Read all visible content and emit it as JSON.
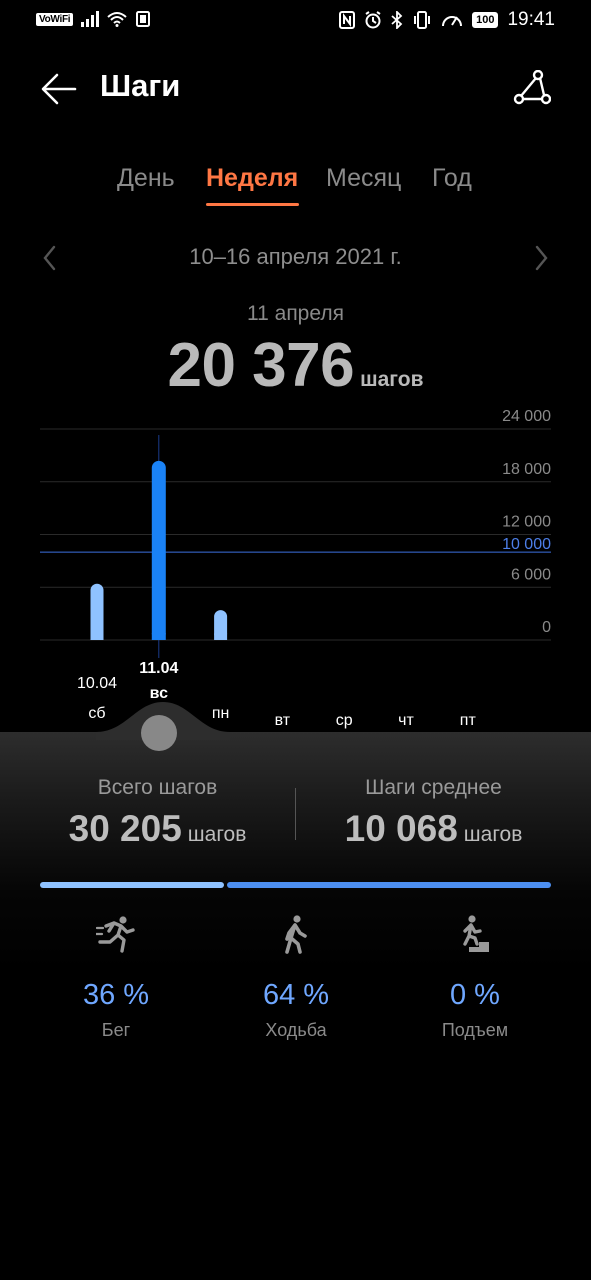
{
  "status": {
    "vowifi": "VoWiFi",
    "battery": "100",
    "time": "19:41"
  },
  "header": {
    "title": "Шаги",
    "back_icon": "arrow-left-icon",
    "share_icon": "share-icon"
  },
  "tabs": [
    {
      "label": "День",
      "active": false
    },
    {
      "label": "Неделя",
      "active": true
    },
    {
      "label": "Месяц",
      "active": false
    },
    {
      "label": "Год",
      "active": false
    }
  ],
  "range": "10–16 апреля 2021 г.",
  "selected": {
    "date": "11 апреля",
    "value": "20 376",
    "unit": "шагов"
  },
  "chart_data": {
    "type": "bar",
    "y_ticks": [
      "24 000",
      "18 000",
      "12 000",
      "6 000",
      "0"
    ],
    "ylim": [
      0,
      24000
    ],
    "goal_line": {
      "value": 10000,
      "label": "10 000",
      "color": "#3d6fe0"
    },
    "days": [
      {
        "date": "10.04",
        "day": "сб",
        "value": 6400,
        "color": "#8fc2ff"
      },
      {
        "date": "11.04",
        "day": "вс",
        "value": 20376,
        "color": "#1a82f5",
        "selected": true
      },
      {
        "date": "",
        "day": "пн",
        "value": 3400,
        "color": "#8fc2ff"
      },
      {
        "date": "",
        "day": "вт",
        "value": 0
      },
      {
        "date": "",
        "day": "ср",
        "value": 0
      },
      {
        "date": "",
        "day": "чт",
        "value": 0
      },
      {
        "date": "",
        "day": "пт",
        "value": 0
      }
    ]
  },
  "summary": {
    "total_label": "Всего шагов",
    "total_value": "30 205",
    "total_unit": "шагов",
    "avg_label": "Шаги среднее",
    "avg_value": "10 068",
    "avg_unit": "шагов"
  },
  "split": {
    "run_fraction": 0.36,
    "run_color": "#8fc2ff",
    "walk_color": "#4d8ff0"
  },
  "activities": [
    {
      "icon": "running-icon",
      "pct": "36 %",
      "label": "Бег"
    },
    {
      "icon": "walking-icon",
      "pct": "64 %",
      "label": "Ходьба"
    },
    {
      "icon": "climbing-stairs-icon",
      "pct": "0 %",
      "label": "Подъем"
    }
  ]
}
